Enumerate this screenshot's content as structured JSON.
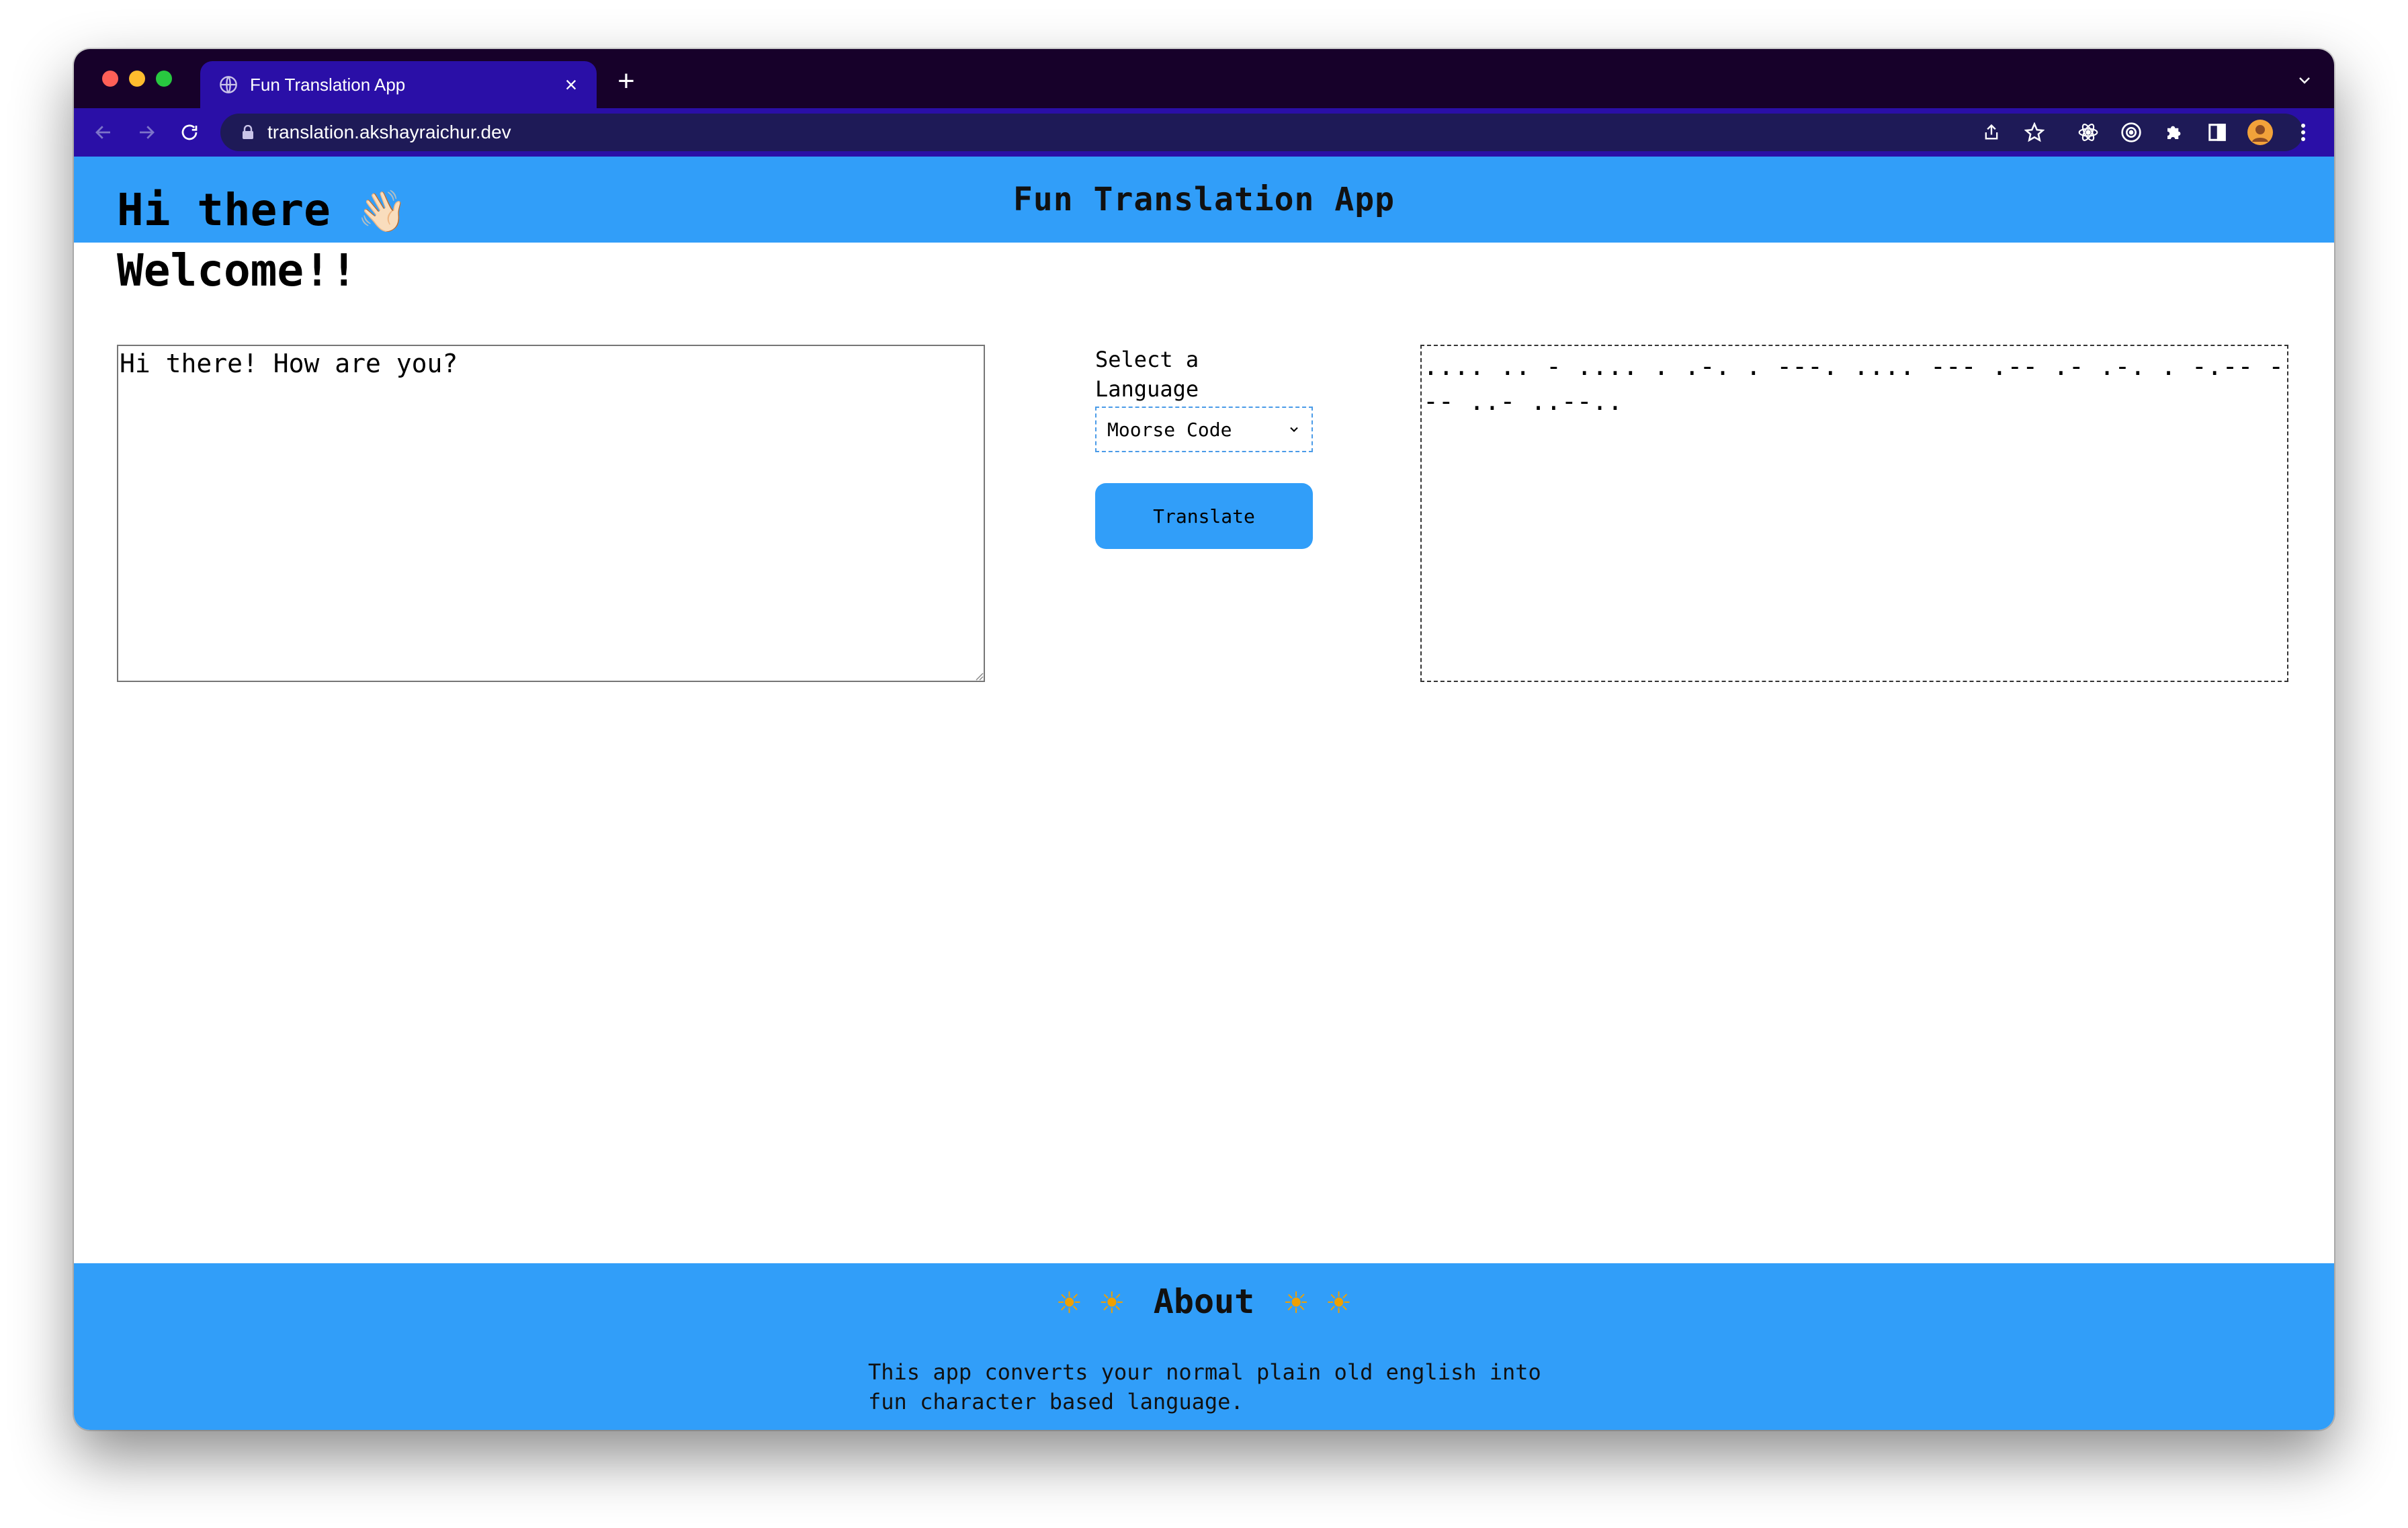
{
  "browser": {
    "tab_title": "Fun Translation App",
    "close_glyph": "×",
    "new_tab_glyph": "+",
    "url": "translation.akshayraichur.dev"
  },
  "app": {
    "header_title": "Fun Translation App",
    "greeting_line1": "Hi there",
    "greeting_emoji": "👋🏻",
    "greeting_line2": "Welcome!!",
    "input_value": "Hi there! How are you?",
    "language_label": "Select a Language",
    "language_selected": "Moorse Code",
    "translate_label": "Translate",
    "output_text": ".... .. - .... . .-. . ---. .... --- .-- .- .-. . -.-- --- ..- ..--..",
    "colors": {
      "accent": "#319ef9",
      "tab_bar": "#17012a",
      "toolbar": "#2a0fa7"
    }
  },
  "footer": {
    "sun_glyph": "☀",
    "about_title": "About",
    "about_text": "This app converts your normal plain old english into fun character based language."
  },
  "icons": [
    "globe-icon",
    "back-arrow-icon",
    "forward-arrow-icon",
    "reload-icon",
    "lock-icon",
    "share-icon",
    "star-icon",
    "react-devtools-icon",
    "target-extension-icon",
    "puzzle-extensions-icon",
    "sidebar-icon",
    "profile-avatar",
    "kebab-menu-icon",
    "chevron-down-icon",
    "sun-icon"
  ]
}
